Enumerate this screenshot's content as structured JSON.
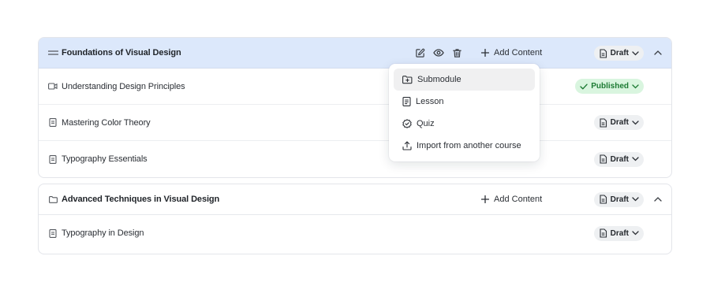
{
  "modules": [
    {
      "title": "Foundations of Visual Design",
      "add_content_label": "Add Content",
      "status": "Draft",
      "lessons": [
        {
          "title": "Understanding Design Principles",
          "icon": "video-icon",
          "status": "Published"
        },
        {
          "title": "Mastering Color Theory",
          "icon": "document-icon",
          "status": "Draft"
        },
        {
          "title": "Typography Essentials",
          "icon": "document-icon",
          "status": "Draft"
        }
      ]
    },
    {
      "title": "Advanced Techniques in Visual Design",
      "add_content_label": "Add Content",
      "status": "Draft",
      "lessons": [
        {
          "title": "Typography in Design",
          "icon": "document-icon",
          "status": "Draft"
        }
      ]
    }
  ],
  "add_menu": {
    "items": [
      {
        "label": "Submodule",
        "icon": "folder-plus-icon",
        "active": true
      },
      {
        "label": "Lesson",
        "icon": "document-icon"
      },
      {
        "label": "Quiz",
        "icon": "check-badge-icon"
      },
      {
        "label": "Import from another course",
        "icon": "upload-icon"
      }
    ]
  },
  "colors": {
    "selected_module_bg": "#dce8fb",
    "published_bg": "#d9f5df",
    "published_text": "#1c7a33",
    "draft_bg": "#eef0f2"
  }
}
